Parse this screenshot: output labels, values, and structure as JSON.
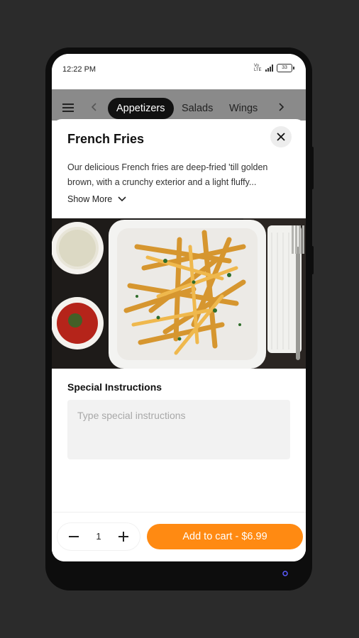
{
  "status_bar": {
    "time": "12:22 PM",
    "network": "Vo LTE",
    "battery": "33"
  },
  "category_nav": {
    "tabs": [
      {
        "label": "Appetizers",
        "active": true
      },
      {
        "label": "Salads",
        "active": false
      },
      {
        "label": "Wings",
        "active": false
      }
    ]
  },
  "item": {
    "title": "French Fries",
    "description": "Our delicious French fries are deep-fried 'till golden brown, with a crunchy exterior and a light fluffy...",
    "show_more": "Show More"
  },
  "special_instructions": {
    "label": "Special Instructions",
    "placeholder": "Type special instructions"
  },
  "cart": {
    "quantity": "1",
    "add_button": "Add to cart - $6.99"
  },
  "colors": {
    "accent": "#ff8a12",
    "category_bar": "#8a8a8a",
    "active_tab": "#111111"
  },
  "icons": [
    "hamburger-menu-icon",
    "chevron-left-icon",
    "chevron-right-icon",
    "close-icon",
    "chevron-down-icon",
    "minus-icon",
    "plus-icon",
    "signal-icon",
    "battery-icon"
  ]
}
